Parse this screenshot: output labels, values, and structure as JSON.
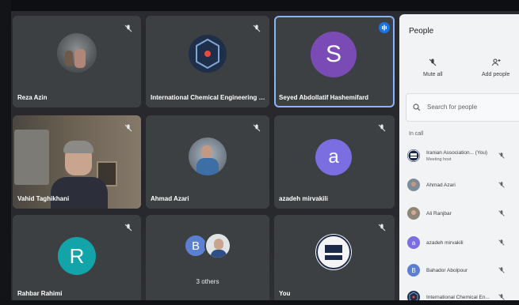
{
  "tiles": [
    {
      "name": "Reza Azin"
    },
    {
      "name": "International Chemical Engineering Cong..."
    },
    {
      "name": "Seyed Abdollatif Hashemifard",
      "initial": "S"
    },
    {
      "name": "Vahid Taghikhani"
    },
    {
      "name": "Ahmad Azari"
    },
    {
      "name": "azadeh mirvakili",
      "initial": "a"
    },
    {
      "name": "Rahbar Rahimi",
      "initial": "R"
    },
    {
      "name": "3 others",
      "initial": "B"
    },
    {
      "name": "You"
    }
  ],
  "panel": {
    "title": "People",
    "mute_all": "Mute all",
    "add_people": "Add people",
    "search_placeholder": "Search for people",
    "section": "In call",
    "people": [
      {
        "name": "Iranian Association...",
        "you": "(You)",
        "sub": "Meeting host"
      },
      {
        "name": "Ahmad Azari"
      },
      {
        "name": "Ali Ranjbar"
      },
      {
        "name": "azadeh mirvakili",
        "initial": "a"
      },
      {
        "name": "Bahador Abolpour",
        "initial": "B"
      },
      {
        "name": "International Chemical En..."
      }
    ]
  },
  "colors": {
    "tile_bg": "#3c4043",
    "speaking": "#1a73e8",
    "avatar_s": "#7b4bb5",
    "avatar_a": "#7a6ee0",
    "avatar_r": "#12a4a8",
    "avatar_b": "#5b7fd1"
  }
}
